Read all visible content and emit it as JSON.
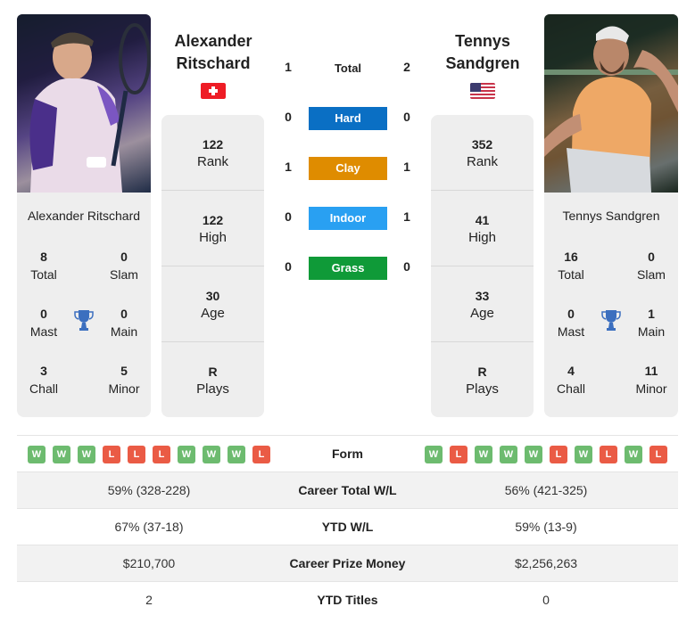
{
  "colors": {
    "hard": "#0a6fc4",
    "clay": "#df8c00",
    "indoor": "#29a0f2",
    "grass": "#0f9a38",
    "win": "#6dbb6f",
    "loss": "#ea5b45",
    "trophy": "#3c6fbf"
  },
  "player1": {
    "name_line1": "Alexander",
    "name_line2": "Ritschard",
    "full_name": "Alexander Ritschard",
    "flag": "switzerland-flag",
    "photo": "player-photo",
    "titles": {
      "total": {
        "value": "8",
        "label": "Total"
      },
      "slam": {
        "value": "0",
        "label": "Slam"
      },
      "mast": {
        "value": "0",
        "label": "Mast"
      },
      "main": {
        "value": "0",
        "label": "Main"
      },
      "chall": {
        "value": "3",
        "label": "Chall"
      },
      "minor": {
        "value": "5",
        "label": "Minor"
      }
    },
    "stats": [
      {
        "value": "122",
        "label": "Rank"
      },
      {
        "value": "122",
        "label": "High"
      },
      {
        "value": "30",
        "label": "Age"
      },
      {
        "value": "R",
        "label": "Plays"
      }
    ],
    "form": [
      "W",
      "W",
      "W",
      "L",
      "L",
      "L",
      "W",
      "W",
      "W",
      "L"
    ],
    "career_wl": "59% (328-228)",
    "ytd_wl": "67% (37-18)",
    "prize_money": "$210,700",
    "ytd_titles": "2"
  },
  "player2": {
    "name_line1": "Tennys",
    "name_line2": "Sandgren",
    "full_name": "Tennys Sandgren",
    "flag": "usa-flag",
    "photo": "player-photo",
    "titles": {
      "total": {
        "value": "16",
        "label": "Total"
      },
      "slam": {
        "value": "0",
        "label": "Slam"
      },
      "mast": {
        "value": "0",
        "label": "Mast"
      },
      "main": {
        "value": "1",
        "label": "Main"
      },
      "chall": {
        "value": "4",
        "label": "Chall"
      },
      "minor": {
        "value": "11",
        "label": "Minor"
      }
    },
    "stats": [
      {
        "value": "352",
        "label": "Rank"
      },
      {
        "value": "41",
        "label": "High"
      },
      {
        "value": "33",
        "label": "Age"
      },
      {
        "value": "R",
        "label": "Plays"
      }
    ],
    "form": [
      "W",
      "L",
      "W",
      "W",
      "W",
      "L",
      "W",
      "L",
      "W",
      "L"
    ],
    "career_wl": "56% (421-325)",
    "ytd_wl": "59% (13-9)",
    "prize_money": "$2,256,263",
    "ytd_titles": "0"
  },
  "h2h": {
    "total": {
      "label": "Total",
      "p1": "1",
      "p2": "2"
    },
    "surfaces": [
      {
        "label": "Hard",
        "p1": "0",
        "p2": "0"
      },
      {
        "label": "Clay",
        "p1": "1",
        "p2": "1"
      },
      {
        "label": "Indoor",
        "p1": "0",
        "p2": "1"
      },
      {
        "label": "Grass",
        "p1": "0",
        "p2": "0"
      }
    ]
  },
  "comparison": {
    "form_label": "Form",
    "career_wl_label": "Career Total W/L",
    "ytd_wl_label": "YTD W/L",
    "prize_label": "Career Prize Money",
    "ytd_titles_label": "YTD Titles"
  }
}
